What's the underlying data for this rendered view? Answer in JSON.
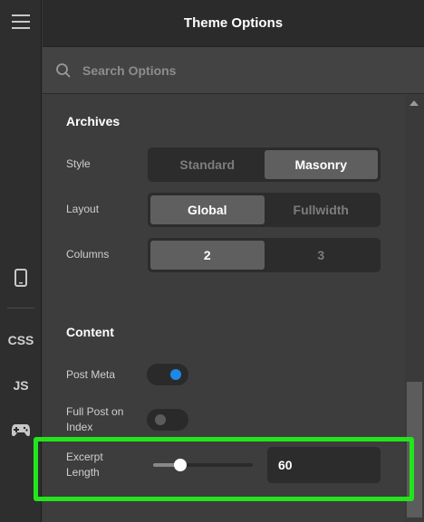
{
  "header": {
    "title": "Theme Options"
  },
  "search": {
    "placeholder": "Search Options"
  },
  "rail": {
    "css_label": "CSS",
    "js_label": "JS"
  },
  "archives": {
    "title": "Archives",
    "style": {
      "label": "Style",
      "options": [
        "Standard",
        "Masonry"
      ],
      "selected": "Masonry"
    },
    "layout": {
      "label": "Layout",
      "options": [
        "Global",
        "Fullwidth"
      ],
      "selected": "Global"
    },
    "columns": {
      "label": "Columns",
      "options": [
        "2",
        "3"
      ],
      "selected": "2"
    }
  },
  "content": {
    "title": "Content",
    "post_meta": {
      "label": "Post Meta",
      "enabled": true
    },
    "full_post": {
      "label_line1": "Full Post on",
      "label_line2": "Index",
      "enabled": false
    },
    "excerpt": {
      "label_line1": "Excerpt",
      "label_line2": "Length",
      "value": "60",
      "slider_fraction": 0.27
    }
  },
  "colors": {
    "accent": "#1e88e5",
    "highlight": "#22e61b"
  }
}
